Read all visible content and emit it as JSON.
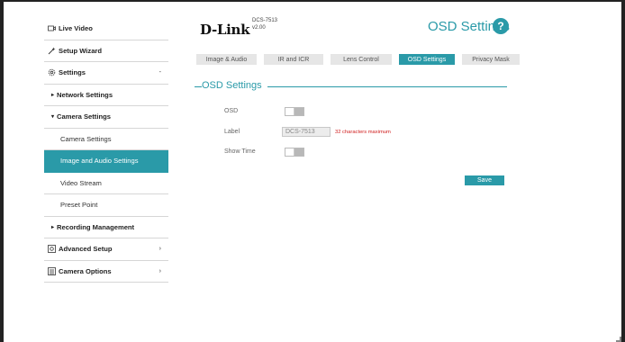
{
  "sidebar": {
    "live_video": "Live Video",
    "setup_wizard": "Setup Wizard",
    "settings": "Settings",
    "settings_caret": "-",
    "network_settings": "Network Settings",
    "camera_settings": "Camera Settings",
    "camera_settings_sub": "Camera Settings",
    "image_audio_settings": "Image and Audio Settings",
    "video_stream": "Video Stream",
    "preset_point": "Preset Point",
    "recording_management": "Recording Management",
    "advanced_setup": "Advanced Setup",
    "advanced_caret": "›",
    "camera_options": "Camera Options",
    "camera_options_caret": "›"
  },
  "header": {
    "logo": "D-Link",
    "model": "DCS-7513",
    "version": "v2.00",
    "page_title": "OSD Settings",
    "help": "?"
  },
  "tabs": [
    {
      "label": "Image & Audio"
    },
    {
      "label": "IR and ICR"
    },
    {
      "label": "Lens Control"
    },
    {
      "label": "OSD Settings"
    },
    {
      "label": "Privacy Mask"
    }
  ],
  "section": {
    "title": "OSD Settings"
  },
  "form": {
    "osd_label": "OSD",
    "label_label": "Label",
    "label_value": "DCS-7513",
    "label_hint": "32 characters maximum",
    "show_time_label": "Show Time",
    "save_label": "Save"
  },
  "colors": {
    "accent": "#2a9aa8",
    "hint": "#d02020"
  }
}
